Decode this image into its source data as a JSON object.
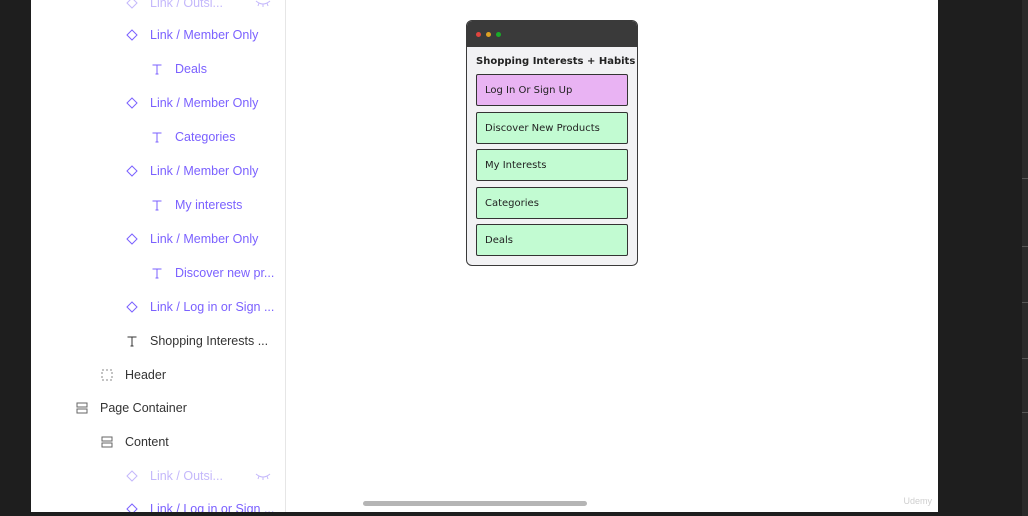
{
  "layers": [
    {
      "label": "Link / Outsi...",
      "icon": "diamond-icon",
      "style": "faded",
      "hidden": true
    },
    {
      "label": "Link / Member Only",
      "icon": "diamond-icon",
      "style": "purple"
    },
    {
      "label": "Deals",
      "icon": "text-icon",
      "style": "purple"
    },
    {
      "label": "Link / Member Only",
      "icon": "diamond-icon",
      "style": "purple"
    },
    {
      "label": "Categories",
      "icon": "text-icon",
      "style": "purple"
    },
    {
      "label": "Link / Member Only",
      "icon": "diamond-icon",
      "style": "purple"
    },
    {
      "label": "My interests",
      "icon": "text-icon",
      "style": "purple"
    },
    {
      "label": "Link / Member Only",
      "icon": "diamond-icon",
      "style": "purple"
    },
    {
      "label": "Discover new pr...",
      "icon": "text-icon",
      "style": "purple"
    },
    {
      "label": "Link / Log in or Sign ...",
      "icon": "diamond-icon",
      "style": "purple"
    },
    {
      "label": "Shopping Interests ...",
      "icon": "text-icon",
      "style": "dark"
    },
    {
      "label": "Header",
      "icon": "frame-dashed-icon",
      "style": "dark"
    },
    {
      "label": "Page Container",
      "icon": "stack-icon",
      "style": "dark"
    },
    {
      "label": "Content",
      "icon": "stack-icon",
      "style": "dark"
    },
    {
      "label": "Link / Outsi...",
      "icon": "diamond-icon",
      "style": "faded",
      "hidden": true
    },
    {
      "label": "Link / Log in or Sign ...",
      "icon": "diamond-icon",
      "style": "purple"
    }
  ],
  "mockup": {
    "title": "Shopping Interests + Habits",
    "window_dots": [
      "#e0443e",
      "#dea123",
      "#1aab29"
    ],
    "buttons": [
      {
        "label": "Log In Or Sign Up",
        "color": "#e9b3f3"
      },
      {
        "label": "Discover New Products",
        "color": "#c2fbd2"
      },
      {
        "label": "My Interests",
        "color": "#c2fbd2"
      },
      {
        "label": "Categories",
        "color": "#c2fbd2"
      },
      {
        "label": "Deals",
        "color": "#c2fbd2"
      }
    ]
  },
  "watermark": "Udemy"
}
